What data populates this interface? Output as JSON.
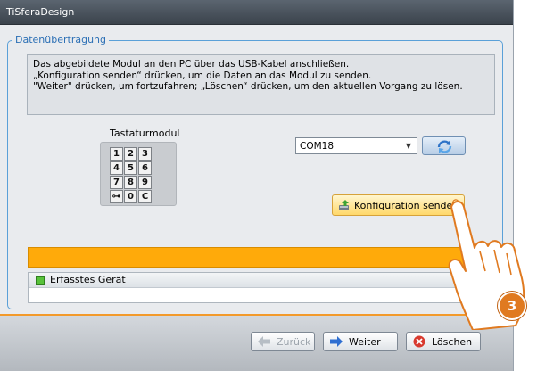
{
  "window": {
    "title": "TiSferaDesign"
  },
  "group": {
    "title": "Datenübertragung"
  },
  "instructions": {
    "line1": "Das abgebildete Modul an den PC über das USB-Kabel anschließen.",
    "line2": "„Konfiguration senden“ drücken, um die Daten an das Modul zu senden.",
    "line3": "\"Weiter\" drücken, um fortzufahren; „Löschen“ drücken, um den aktuellen Vorgang zu lösen."
  },
  "module": {
    "label": "Tastaturmodul",
    "keys": [
      "1",
      "2",
      "3",
      "4",
      "5",
      "6",
      "7",
      "8",
      "9",
      "⊶",
      "0",
      "C"
    ]
  },
  "port": {
    "selected": "COM18",
    "refresh_icon": "refresh-icon"
  },
  "send_button": {
    "label": "Konfiguration senden",
    "icon": "upload-device-icon"
  },
  "progress": {
    "value": 1.0,
    "color": "#ffaa0a"
  },
  "device_list": {
    "items": [
      {
        "label": "Erfasstes Gerät",
        "status_color": "#58c23a"
      }
    ]
  },
  "footer": {
    "back_label": "Zurück",
    "next_label": "Weiter",
    "delete_label": "Löschen"
  },
  "annotation": {
    "step": "3"
  },
  "colors": {
    "accent": "#f39a2b",
    "title_bar": "#4a535d",
    "group_border": "#5aa0d8"
  }
}
